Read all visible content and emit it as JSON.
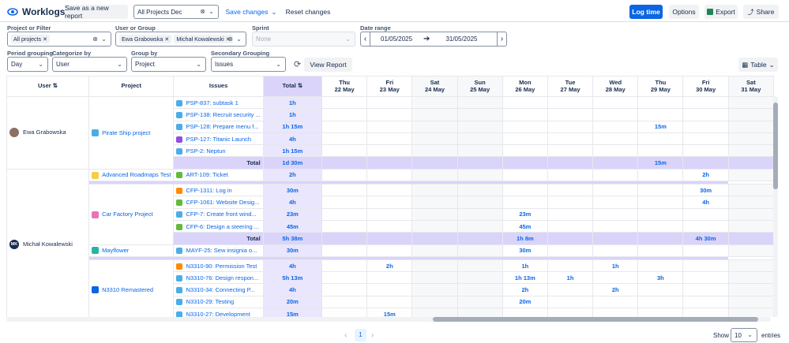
{
  "header": {
    "title": "Worklogs",
    "save_new": "Save as a new report",
    "report_select": "All Projects Dec",
    "save_changes": "Save changes",
    "reset_changes": "Reset changes",
    "log_time": "Log time",
    "options": "Options",
    "export": "Export",
    "share": "Share"
  },
  "filters": {
    "project_label": "Project or Filter",
    "project_chip": "All projects",
    "user_label": "User or Group",
    "user_chips": [
      "Ewa Grabowska",
      "Michał Kowalewski"
    ],
    "sprint_label": "Sprint",
    "sprint_placeholder": "None",
    "date_label": "Date range",
    "date_from": "01/05/2025",
    "date_to": "31/05/2025",
    "period_label": "Period grouping",
    "period_value": "Day",
    "categorize_label": "Categorize by",
    "categorize_value": "User",
    "group_label": "Group by",
    "group_value": "Project",
    "secondary_label": "Secondary Grouping",
    "secondary_value": "Issues",
    "view_report": "View Report",
    "view_mode": "Table"
  },
  "table": {
    "headers": {
      "user": "User",
      "project": "Project",
      "issues": "Issues",
      "total": "Total"
    },
    "days": [
      {
        "d": "Thu",
        "date": "22 May"
      },
      {
        "d": "Fri",
        "date": "23 May"
      },
      {
        "d": "Sat",
        "date": "24 May"
      },
      {
        "d": "Sun",
        "date": "25 May"
      },
      {
        "d": "Mon",
        "date": "26 May"
      },
      {
        "d": "Tue",
        "date": "27 May"
      },
      {
        "d": "Wed",
        "date": "28 May"
      },
      {
        "d": "Thu",
        "date": "29 May"
      },
      {
        "d": "Fri",
        "date": "30 May"
      },
      {
        "d": "Sat",
        "date": "31 May"
      }
    ],
    "user1": "Ewa Grabowska",
    "user2": "Michał Kowalewski",
    "user2_initials": "MK",
    "projects": {
      "pirate": "Pirate Ship project",
      "roadmaps": "Advanced Roadmaps Test",
      "car": "Car Factory Project",
      "mayflower": "Mayflower",
      "n3310": "N3310 Remastered"
    },
    "total_label": "Total",
    "rows": {
      "r1": {
        "issue": "PSP-837: subtask 1",
        "total": "1h",
        "days": [
          "",
          "",
          "",
          "",
          "",
          "",
          "",
          "",
          "",
          ""
        ]
      },
      "r2": {
        "issue": "PSP-138: Recruit security ...",
        "total": "1h",
        "days": [
          "",
          "",
          "",
          "",
          "",
          "",
          "",
          "",
          "",
          ""
        ]
      },
      "r3": {
        "issue": "PSP-128: Prepare menu f...",
        "total": "1h 15m",
        "days": [
          "",
          "",
          "",
          "",
          "",
          "",
          "",
          "15m",
          "",
          ""
        ]
      },
      "r4": {
        "issue": "PSP-127: Titanic Launch",
        "total": "4h",
        "days": [
          "",
          "",
          "",
          "",
          "",
          "",
          "",
          "",
          "",
          ""
        ]
      },
      "r5": {
        "issue": "PSP-2: Neptun",
        "total": "1h 15m",
        "days": [
          "",
          "",
          "",
          "",
          "",
          "",
          "",
          "",
          "",
          ""
        ]
      },
      "t1": {
        "total": "1d 30m",
        "days": [
          "",
          "",
          "",
          "",
          "",
          "",
          "",
          "15m",
          "",
          ""
        ]
      },
      "r6": {
        "issue": "ART-109: Ticket",
        "total": "2h",
        "days": [
          "",
          "",
          "",
          "",
          "",
          "",
          "",
          "",
          "2h",
          ""
        ]
      },
      "r7": {
        "issue": "CFP-1311: Log in",
        "total": "30m",
        "days": [
          "",
          "",
          "",
          "",
          "",
          "",
          "",
          "",
          "30m",
          ""
        ]
      },
      "r8": {
        "issue": "CFP-1061: Website Desig...",
        "total": "4h",
        "days": [
          "",
          "",
          "",
          "",
          "",
          "",
          "",
          "",
          "4h",
          ""
        ]
      },
      "r9": {
        "issue": "CFP-7: Create front wind...",
        "total": "23m",
        "days": [
          "",
          "",
          "",
          "",
          "23m",
          "",
          "",
          "",
          "",
          ""
        ]
      },
      "r10": {
        "issue": "CFP-6: Design a steering ...",
        "total": "45m",
        "days": [
          "",
          "",
          "",
          "",
          "45m",
          "",
          "",
          "",
          "",
          ""
        ]
      },
      "t2": {
        "total": "5h 38m",
        "days": [
          "",
          "",
          "",
          "",
          "1h 8m",
          "",
          "",
          "",
          "4h 30m",
          ""
        ]
      },
      "r11": {
        "issue": "MAYF-25: Sew insignia o...",
        "total": "30m",
        "days": [
          "",
          "",
          "",
          "",
          "30m",
          "",
          "",
          "",
          "",
          ""
        ]
      },
      "r12": {
        "issue": "N3310-90: Permission Test",
        "total": "4h",
        "days": [
          "",
          "2h",
          "",
          "",
          "1h",
          "",
          "1h",
          "",
          "",
          ""
        ]
      },
      "r13": {
        "issue": "N3310-76: Design respon...",
        "total": "5h 13m",
        "days": [
          "",
          "",
          "",
          "",
          "1h 13m",
          "1h",
          "",
          "3h",
          "",
          ""
        ]
      },
      "r14": {
        "issue": "N3310-34: Connecting P...",
        "total": "4h",
        "days": [
          "",
          "",
          "",
          "",
          "2h",
          "",
          "2h",
          "",
          "",
          ""
        ]
      },
      "r15": {
        "issue": "N3310-29: Testing",
        "total": "20m",
        "days": [
          "",
          "",
          "",
          "",
          "20m",
          "",
          "",
          "",
          "",
          ""
        ]
      },
      "r16": {
        "issue": "N3310-27: Development",
        "total": "15m",
        "days": [
          "",
          "15m",
          "",
          "",
          "",
          "",
          "",
          "",
          "",
          ""
        ]
      }
    }
  },
  "pagination": {
    "current": "1",
    "show_label": "Show",
    "per_page": "10",
    "entries_label": "entries"
  }
}
